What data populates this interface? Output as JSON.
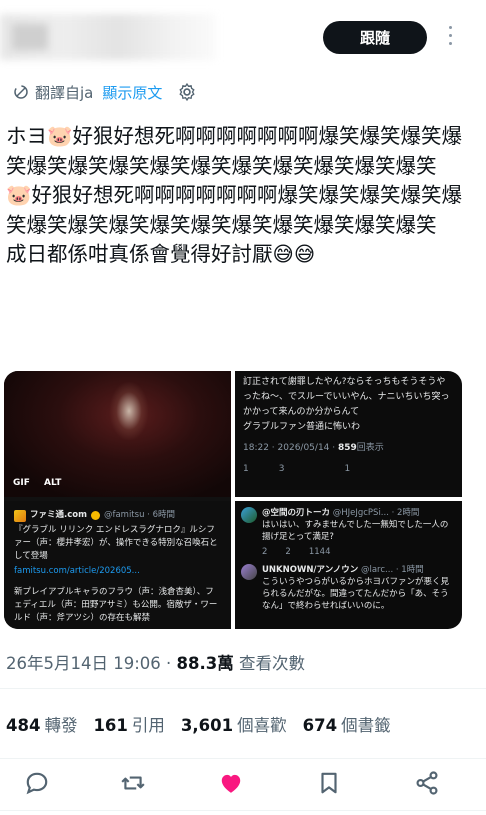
{
  "header": {
    "follow_label": "跟隨"
  },
  "translate": {
    "label": "翻譯自ja",
    "show_original": "顯示原文"
  },
  "tweet": {
    "lines": [
      "ホヨ🐷好狠好想死啊啊啊啊啊啊啊爆笑爆笑爆笑爆笑爆笑爆笑爆笑爆笑爆笑爆笑爆笑爆笑爆笑爆笑",
      "🐷好狠好想死啊啊啊啊啊啊啊爆笑爆笑爆笑爆笑爆笑爆笑爆笑爆笑爆笑爆笑爆笑爆笑爆笑爆笑爆笑",
      "成日都係咁真係會覺得好討厭😅😅"
    ]
  },
  "media": {
    "gif_badge": "GIF",
    "alt_badge": "ALT",
    "quote": {
      "name": "ファミ通.com",
      "handle": "@famitsu · 6時間",
      "text": "『グラブル リリンク エンドレスラグナロク』ルシファー（声：櫻井孝宏）が、操作できる特別な召喚石として登場",
      "link": "famitsu.com/article/202605...",
      "text2": "新プレイアブルキャラのフラウ（声：浅倉杏美）、フェディエル（声：田野アサミ）も公開。宿敵ザ・ワールド（声：斧アツシ）の存在も解禁"
    },
    "right_top": {
      "lines": [
        "訂正されて謝罪したやん?ならそっちもそうそうやったね〜、でスルーでいいやん、ナニいちいち突っかかって来んのか分からんて",
        "グラブルファン普通に怖いわ"
      ],
      "time": "18:22 · 2026/05/14 · ",
      "views": "859",
      "views_label": "回表示",
      "counts": [
        "1",
        "3",
        "",
        "1",
        ""
      ]
    },
    "replies": [
      {
        "name": "@空間の刃トーカ",
        "meta": "@HJeJgcPSi... · 2時間",
        "text": "はいはい、すみませんでした一無知でした一人の揚げ足とって満足?",
        "counts": [
          "2",
          "2",
          "",
          "1144",
          ""
        ]
      },
      {
        "name": "UNKNOWN/アンノウン",
        "meta": "@larc... · 1時間",
        "text": "こういうやつらがいるからホヨバファンが悪く見られるんだがな。間違ってたんだから「あ、そうなん」で終わらせればいいのに。",
        "counts": []
      }
    ]
  },
  "timestamp": {
    "datetime": "26年5月14日 19:06 · ",
    "views": "88.3萬",
    "views_label": " 查看次數"
  },
  "stats": {
    "retweets": "484",
    "retweets_label": "轉發",
    "quotes": "161",
    "quotes_label": "引用",
    "likes": "3,601",
    "likes_label": "個喜歡",
    "bookmarks": "674",
    "bookmarks_label": "個書籤"
  },
  "colors": {
    "like_active": "#f91880",
    "icon_gray": "#536471",
    "link_blue": "#1d9bf0"
  }
}
